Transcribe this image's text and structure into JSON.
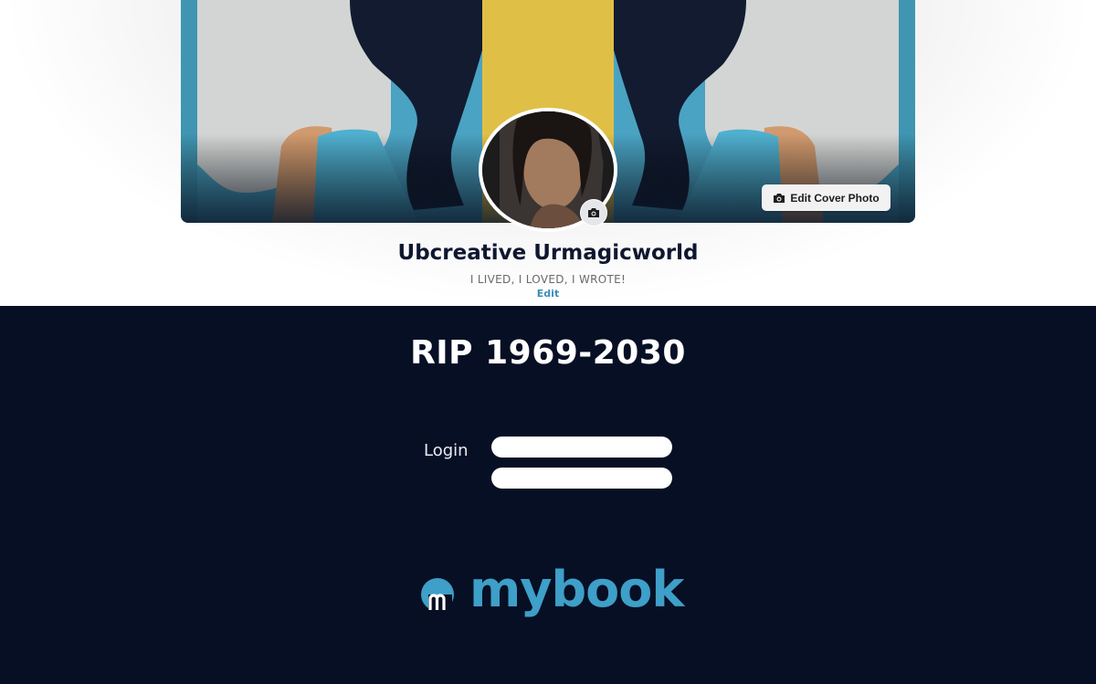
{
  "profile": {
    "name": "Ubcreative Urmagicworld",
    "tagline": "I LIVED, I LOVED, I WROTE!",
    "edit_label": "Edit",
    "edit_cover_label": "Edit Cover Photo"
  },
  "memorial": {
    "title": "RIP 1969-2030"
  },
  "login": {
    "label": "Login",
    "username_value": "",
    "password_value": ""
  },
  "brand": {
    "name": "mybook",
    "logo_mark_letter": "m",
    "color": "#3e9fc8"
  },
  "icons": {
    "edit_cover": "camera-icon",
    "avatar_edit": "camera-icon"
  },
  "colors": {
    "background_dark": "#070f24",
    "accent_blue": "#3c8db5",
    "cover_yellow": "#e0bf47",
    "cover_teal": "#4aa3c3"
  }
}
